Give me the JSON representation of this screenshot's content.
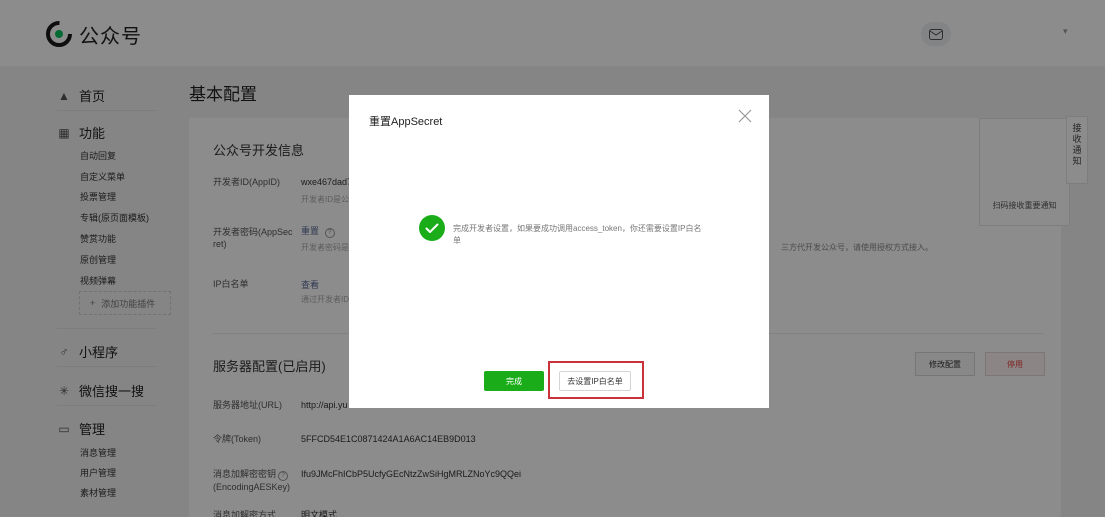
{
  "header": {
    "brand": "公众号"
  },
  "sidebar": {
    "home": "首页",
    "functions": {
      "title": "功能",
      "items": [
        "自动回复",
        "自定义菜单",
        "投票管理",
        "专辑(原页面模板)",
        "赞赏功能",
        "原创管理",
        "视频弹幕"
      ],
      "add_plugin": "添加功能插件"
    },
    "mini_program": "小程序",
    "wechat_search": "微信搜一搜",
    "manage": {
      "title": "管理",
      "items": [
        "消息管理",
        "用户管理",
        "素材管理"
      ]
    }
  },
  "main": {
    "title": "基本配置",
    "dev_info": {
      "title": "公众号开发信息",
      "appid_label": "开发者ID(AppID)",
      "appid_value": "wxe467dad7",
      "appid_sub": "开发者ID是公",
      "secret_label_1": "开发者密码(AppSec",
      "secret_label_2": "ret)",
      "secret_action": "重置",
      "secret_help": "?",
      "secret_sub": "开发者密码是",
      "secret_sub_tail": "三方代开发公众号，请使用授权方式接入。",
      "ip_label": "IP白名单",
      "ip_action": "查看",
      "ip_sub": "通过开发者ID"
    },
    "scan_notify": "扫码接收重要通知",
    "server": {
      "title": "服务器配置(已启用)",
      "edit_button": "修改配置",
      "stop_button": "停用",
      "url_label": "服务器地址(URL)",
      "url_value": "http://api.yu",
      "token_label": "令牌(Token)",
      "token_value": "5FFCD54E1C0871424A1A6AC14EB9D013",
      "aes_label_1": "消息加解密密钥",
      "aes_help": "?",
      "aes_label_2": "(EncodingAESKey)",
      "aes_value": "Ifu9JMcFhICbP5UcfyGEcNtzZwSiHgMRLZNoYc9QQei",
      "mode_label": "消息加解密方式",
      "mode_value": "明文模式"
    }
  },
  "notify_tab": [
    "接",
    "收",
    "通",
    "知"
  ],
  "dialog": {
    "title": "重置AppSecret",
    "message": "完成开发者设置，如果要成功调用access_token，你还需要设置IP白名单",
    "done_button": "完成",
    "set_ip_button": "去设置IP白名单"
  },
  "colors": {
    "primary": "#1aad19",
    "danger": "#e64340",
    "highlight": "#c8323a",
    "link": "#576b95"
  }
}
